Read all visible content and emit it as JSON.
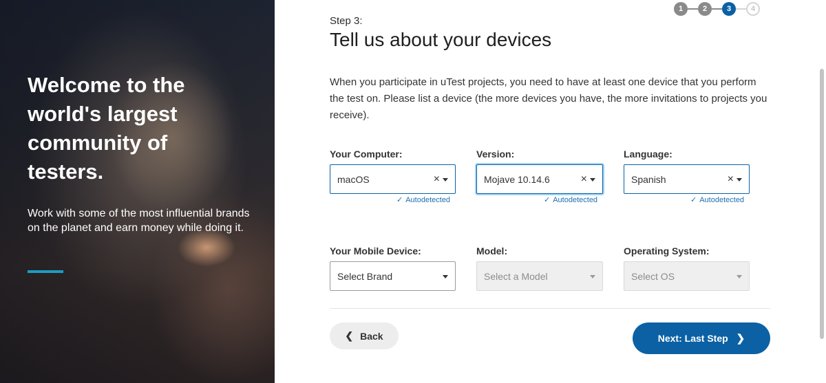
{
  "hero": {
    "heading": "Welcome to the world's largest community of testers.",
    "subtext": "Work with some of the most influential brands on the planet and earn money while doing it."
  },
  "stepper": {
    "steps": [
      "1",
      "2",
      "3",
      "4"
    ],
    "current": 3
  },
  "page": {
    "step_label": "Step 3:",
    "title": "Tell us about your devices",
    "intro": "When you participate in uTest projects, you need to have at least one device that you perform the test on. Please list a device (the more devices you have, the more invitations to projects you receive)."
  },
  "computer": {
    "computer_label": "Your Computer:",
    "computer_value": "macOS",
    "version_label": "Version:",
    "version_value": "Mojave 10.14.6",
    "language_label": "Language:",
    "language_value": "Spanish",
    "autodetected": "Autodetected"
  },
  "mobile": {
    "device_label": "Your Mobile Device:",
    "device_placeholder": "Select Brand",
    "model_label": "Model:",
    "model_placeholder": "Select a Model",
    "os_label": "Operating System:",
    "os_placeholder": "Select OS"
  },
  "actions": {
    "back_label": "Back",
    "next_label": "Next: Last Step"
  },
  "colors": {
    "primary": "#0b61a4",
    "accent": "#1d9cc2",
    "autodetect": "#1e6fb2"
  },
  "icons": {
    "clear": "close-icon",
    "dropdown": "caret-down-icon",
    "check": "check-icon",
    "back": "chevron-left-icon",
    "next": "chevron-right-icon"
  }
}
